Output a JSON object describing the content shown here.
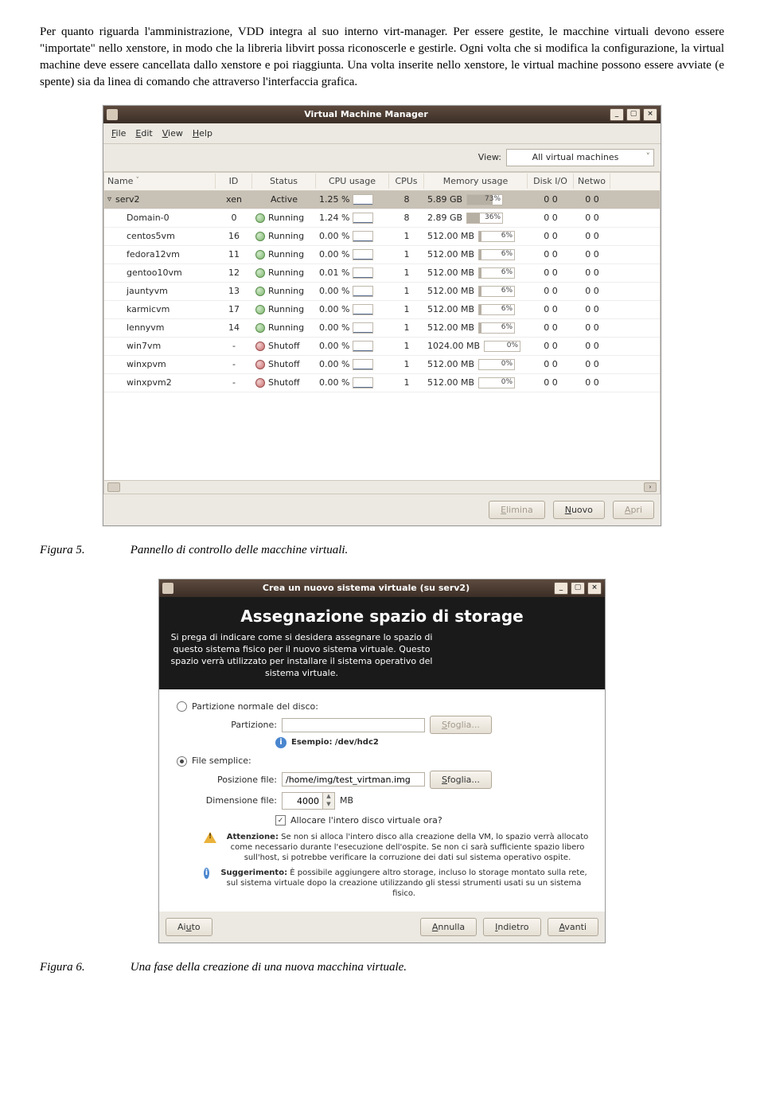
{
  "paragraph": "Per quanto riguarda l'amministrazione, VDD integra al suo interno virt-manager. Per essere gestite, le macchine virtuali devono essere \"importate\" nello xenstore, in modo che la libreria libvirt possa riconoscerle e gestirle. Ogni volta che si modifica la configurazione, la virtual machine deve essere cancellata dallo xenstore e poi riaggiunta. Una volta inserite nello xenstore, le virtual machine possono essere avviate (e spente) sia da linea di comando che attraverso l'interfaccia grafica.",
  "fig5": {
    "num": "Figura 5.",
    "caption": "Pannello di controllo delle macchine virtuali."
  },
  "fig6": {
    "num": "Figura 6.",
    "caption": "Una fase della creazione di una nuova macchina virtuale."
  },
  "vmm": {
    "title": "Virtual Machine Manager",
    "menu": {
      "file": "File",
      "edit": "Edit",
      "view": "View",
      "help": "Help"
    },
    "view_label_text": "View:",
    "view_select": "All virtual machines",
    "headers": {
      "name": "Name",
      "id": "ID",
      "status": "Status",
      "cpu": "CPU usage",
      "cpus": "CPUs",
      "mem": "Memory usage",
      "disk": "Disk I/O",
      "net": "Netwo"
    },
    "host": {
      "name": "serv2",
      "id": "xen",
      "status": "Active",
      "cpu": "1.25 %",
      "cpus": "8",
      "mem_text": "5.89 GB",
      "mem_pct": "73%",
      "disk": "0 0",
      "net": "0 0"
    },
    "rows": [
      {
        "name": "Domain-0",
        "id": "0",
        "status": "Running",
        "run": true,
        "cpu": "1.24 %",
        "cpus": "8",
        "mem_text": "2.89 GB",
        "mem_pct": "36%",
        "disk": "0 0",
        "net": "0 0"
      },
      {
        "name": "centos5vm",
        "id": "16",
        "status": "Running",
        "run": true,
        "cpu": "0.00 %",
        "cpus": "1",
        "mem_text": "512.00 MB",
        "mem_pct": "6%",
        "disk": "0 0",
        "net": "0 0"
      },
      {
        "name": "fedora12vm",
        "id": "11",
        "status": "Running",
        "run": true,
        "cpu": "0.00 %",
        "cpus": "1",
        "mem_text": "512.00 MB",
        "mem_pct": "6%",
        "disk": "0 0",
        "net": "0 0"
      },
      {
        "name": "gentoo10vm",
        "id": "12",
        "status": "Running",
        "run": true,
        "cpu": "0.01 %",
        "cpus": "1",
        "mem_text": "512.00 MB",
        "mem_pct": "6%",
        "disk": "0 0",
        "net": "0 0"
      },
      {
        "name": "jauntyvm",
        "id": "13",
        "status": "Running",
        "run": true,
        "cpu": "0.00 %",
        "cpus": "1",
        "mem_text": "512.00 MB",
        "mem_pct": "6%",
        "disk": "0 0",
        "net": "0 0"
      },
      {
        "name": "karmicvm",
        "id": "17",
        "status": "Running",
        "run": true,
        "cpu": "0.00 %",
        "cpus": "1",
        "mem_text": "512.00 MB",
        "mem_pct": "6%",
        "disk": "0 0",
        "net": "0 0"
      },
      {
        "name": "lennyvm",
        "id": "14",
        "status": "Running",
        "run": true,
        "cpu": "0.00 %",
        "cpus": "1",
        "mem_text": "512.00 MB",
        "mem_pct": "6%",
        "disk": "0 0",
        "net": "0 0"
      },
      {
        "name": "win7vm",
        "id": "-",
        "status": "Shutoff",
        "run": false,
        "cpu": "0.00 %",
        "cpus": "1",
        "mem_text": "1024.00 MB",
        "mem_pct": "0%",
        "disk": "0 0",
        "net": "0 0"
      },
      {
        "name": "winxpvm",
        "id": "-",
        "status": "Shutoff",
        "run": false,
        "cpu": "0.00 %",
        "cpus": "1",
        "mem_text": "512.00 MB",
        "mem_pct": "0%",
        "disk": "0 0",
        "net": "0 0"
      },
      {
        "name": "winxpvm2",
        "id": "-",
        "status": "Shutoff",
        "run": false,
        "cpu": "0.00 %",
        "cpus": "1",
        "mem_text": "512.00 MB",
        "mem_pct": "0%",
        "disk": "0 0",
        "net": "0 0"
      }
    ],
    "buttons": {
      "elimina": "Elimina",
      "nuovo": "Nuovo",
      "apri": "Apri"
    }
  },
  "wiz": {
    "title": "Crea un nuovo sistema virtuale (su serv2)",
    "heading": "Assegnazione spazio di storage",
    "intro": "Si prega di indicare come si desidera assegnare lo spazio di questo sistema fisico per il nuovo sistema virtuale. Questo spazio verrà utilizzato per installare il sistema operativo del sistema virtuale.",
    "opt_partition": "Partizione normale del disco:",
    "partition_label": "Partizione:",
    "partition_value": "",
    "browse": "Sfoglia...",
    "example_label": "Esempio: /dev/hdc2",
    "opt_file": "File semplice:",
    "file_label": "Posizione file:",
    "file_value": "/home/img/test_virtman.img",
    "size_label": "Dimensione file:",
    "size_value": "4000",
    "size_unit": "MB",
    "allocate": "Allocare l'intero disco virtuale ora?",
    "warn_title": "Attenzione:",
    "warn_text": "Se non si alloca l'intero disco alla creazione della VM, lo spazio verrà allocato come necessario durante l'esecuzione dell'ospite. Se non ci sarà sufficiente spazio libero sull'host, si potrebbe verificare la corruzione dei dati sul sistema operativo ospite.",
    "tip_title": "Suggerimento:",
    "tip_text": "È possibile aggiungere altro storage, incluso lo storage montato sulla rete, sul sistema virtuale dopo la creazione utilizzando gli stessi strumenti usati su un sistema fisico.",
    "buttons": {
      "aiuto": "Aiuto",
      "annulla": "Annulla",
      "indietro": "Indietro",
      "avanti": "Avanti"
    }
  }
}
